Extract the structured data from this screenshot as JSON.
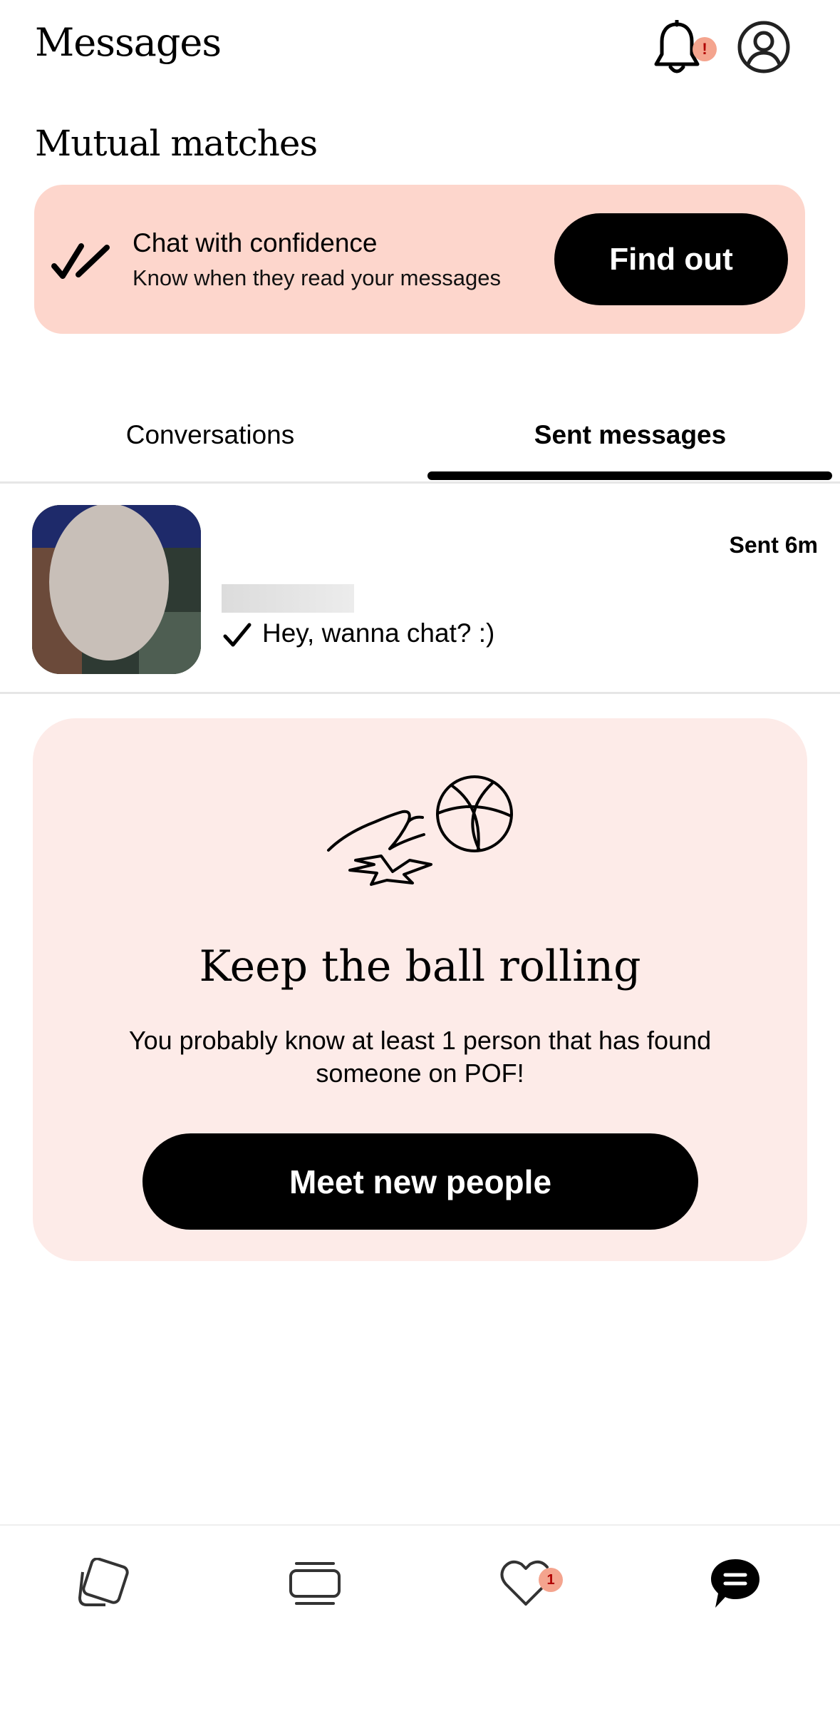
{
  "header": {
    "title": "Messages",
    "notification_badge": "!",
    "icons": [
      "bell-icon",
      "profile-icon"
    ]
  },
  "section": {
    "mutual_matches": "Mutual matches"
  },
  "promo": {
    "title": "Chat with confidence",
    "subtitle": "Know when they read your messages",
    "button": "Find out",
    "background": "#fdd6cc"
  },
  "tabs": {
    "items": [
      {
        "label": "Conversations",
        "active": false
      },
      {
        "label": "Sent messages",
        "active": true
      }
    ]
  },
  "messages": [
    {
      "sent": "Sent 6m",
      "preview": "Hey, wanna chat? :)",
      "status": "sent-check"
    }
  ],
  "empty_card": {
    "title": "Keep the ball rolling",
    "body": "You probably know at least 1 person that has found someone on POF!",
    "button": "Meet new people",
    "background": "#fdebe8"
  },
  "nav": {
    "items": [
      "discover-icon",
      "browse-icon",
      "likes-icon",
      "messages-icon"
    ],
    "likes_badge": "1",
    "active": "messages"
  },
  "colors": {
    "accent": "#f4a48e",
    "text": "#000000"
  }
}
